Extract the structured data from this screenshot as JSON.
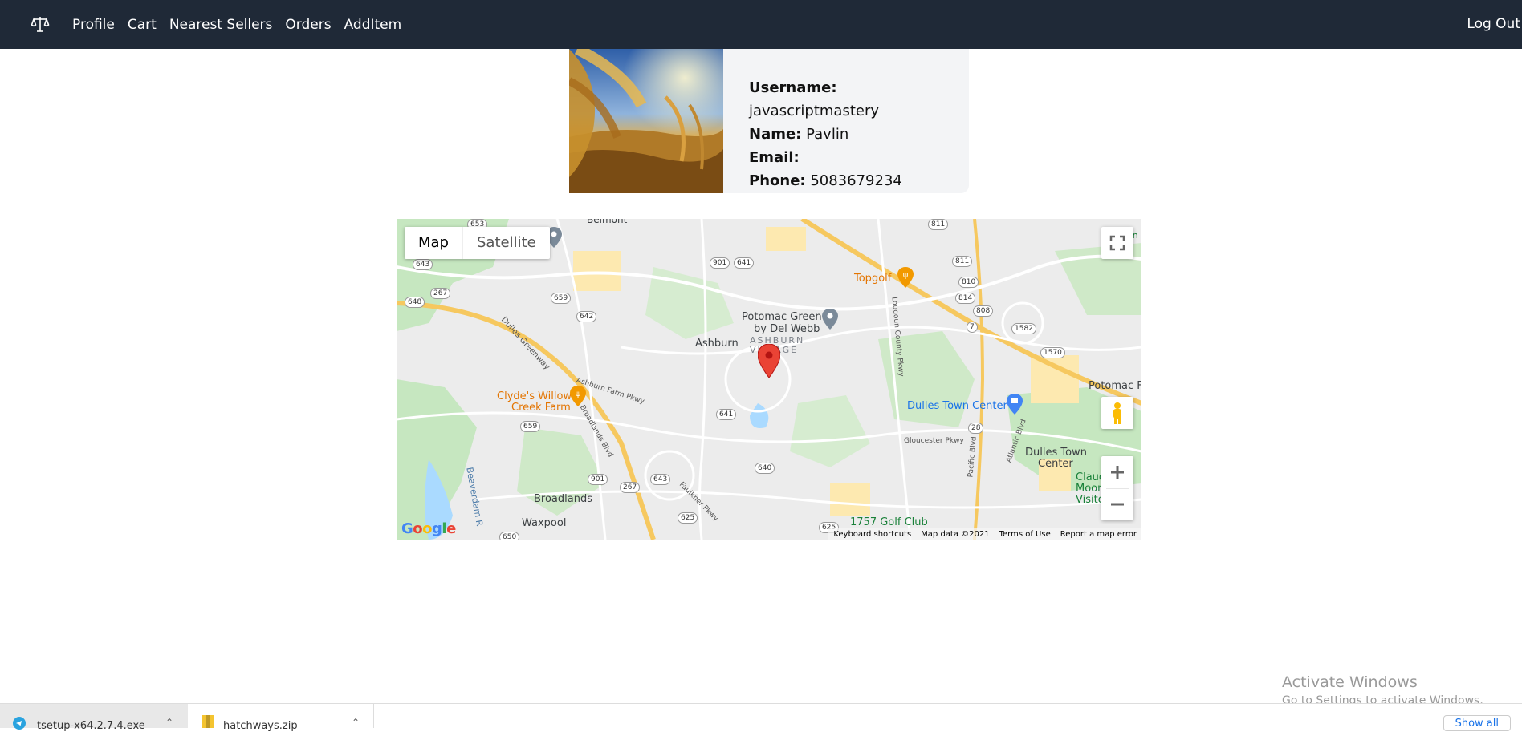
{
  "nav": {
    "logo_icon": "balance-scale-icon",
    "links": [
      "Profile",
      "Cart",
      "Nearest Sellers",
      "Orders",
      "AddItem"
    ],
    "logout": "Log Out"
  },
  "profile": {
    "username_label": "Username:",
    "username": "javascriptmastery",
    "name_label": "Name:",
    "name": "Pavlin",
    "email_label": "Email:",
    "email": "",
    "phone_label": "Phone:",
    "phone": "5083679234"
  },
  "map": {
    "type_map": "Map",
    "type_satellite": "Satellite",
    "places": {
      "belmont": "Belmont",
      "ashburn": "Ashburn",
      "potomac_green": "Potomac Green",
      "by_del_webb": "by Del Webb",
      "ashburn_village_1": "ASHBURN",
      "ashburn_village_2": "VILLAGE",
      "topgolf": "Topgolf",
      "clydes_1": "Clyde's Willow",
      "clydes_2": "Creek Farm",
      "dulles_town_center": "Dulles Town Center",
      "dulles_town_1": "Dulles Town",
      "dulles_town_2": "Center",
      "potomac_fa": "Potomac Fa",
      "broadlands": "Broadlands",
      "waxpool": "Waxpool",
      "golf_club": "1757 Golf Club",
      "claude_1": "Claud",
      "claude_2": "Moore P",
      "claude_3": "Visitor C",
      "beaverdam": "Beaverdam R",
      "dulles_greenway": "Dulles Greenway",
      "ashburn_farm_pkwy": "Ashburn Farm Pkwy",
      "broadlands_blvd": "Broadlands Blvd",
      "loudoun_county_pkwy": "Loudoun County Pkwy",
      "gloucester_pkwy": "Gloucester Pkwy",
      "pacific_blvd": "Pacific Blvd",
      "atlantic_blvd": "Atlantic Blvd",
      "faulkner_pkwy": "Faulkner Pkwy",
      "on": "on"
    },
    "shields": {
      "r653": "653",
      "r643": "643",
      "r648": "648",
      "r267a": "267",
      "r659a": "659",
      "r642": "642",
      "r901a": "901",
      "r641a": "641",
      "r641b": "641",
      "r659b": "659",
      "r901b": "901",
      "r267b": "267",
      "r643b": "643",
      "r640": "640",
      "r625a": "625",
      "r625b": "625",
      "r811a": "811",
      "r811b": "811",
      "r810": "810",
      "r814": "814",
      "r808": "808",
      "r7": "7",
      "r1582": "1582",
      "r1570": "1570",
      "r28": "28",
      "r650": "650"
    },
    "footer": [
      "Keyboard shortcuts",
      "Map data ©2021",
      "Terms of Use",
      "Report a map error"
    ],
    "google": "Google",
    "icons": [
      "fullscreen-icon",
      "pegman-icon",
      "zoom-in-icon",
      "zoom-out-icon",
      "map-marker-icon"
    ]
  },
  "watermark": {
    "line1": "Activate Windows",
    "line2": "Go to Settings to activate Windows."
  },
  "downloads": {
    "file1": "tsetup-x64.2.7.4.exe",
    "file2": "hatchways.zip",
    "show_all": "Show all"
  }
}
